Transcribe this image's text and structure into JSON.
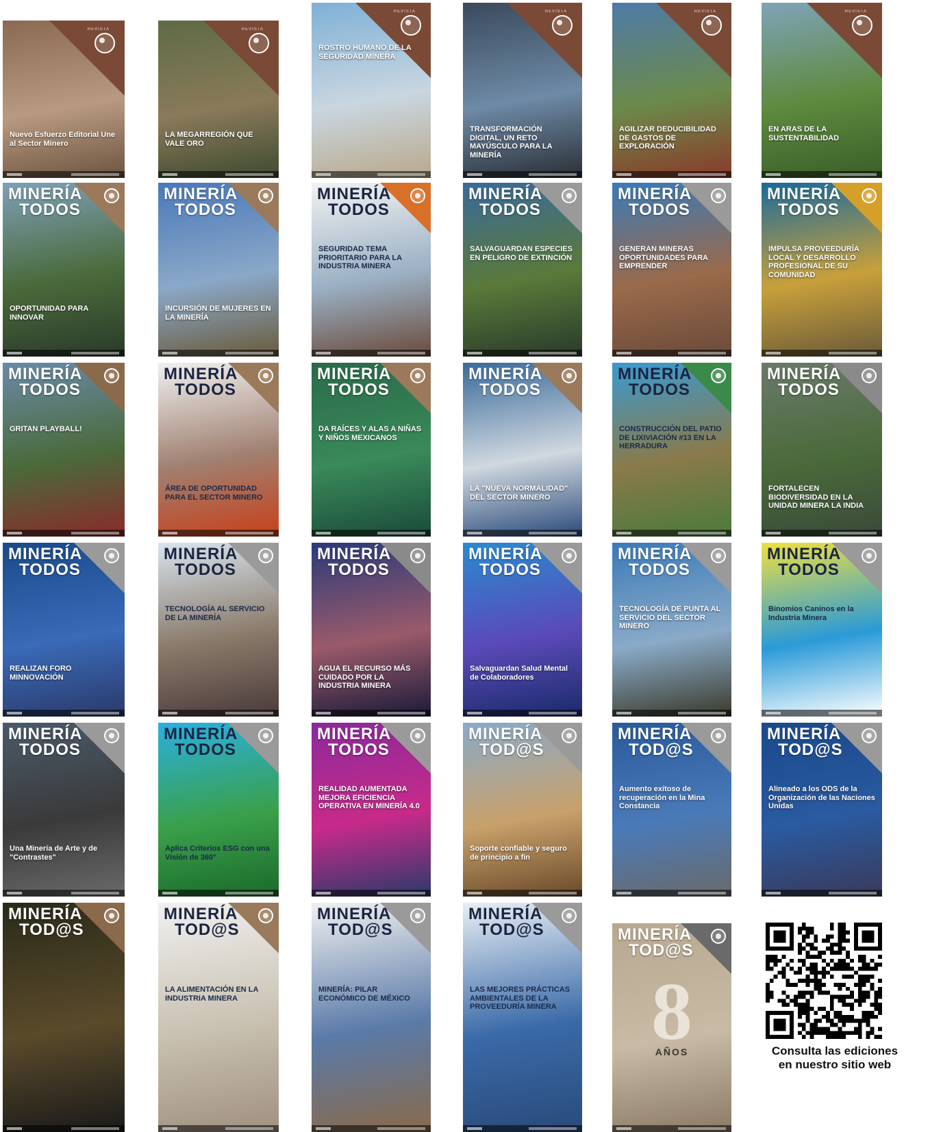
{
  "covers": [
    {
      "id": "c01",
      "era": "old",
      "headline": "Nuevo Esfuerzo Editorial Une al Sector Minero",
      "sub": "",
      "mast1": "",
      "mast2": "",
      "top_label": "REVISTA",
      "colors": [
        "#8a6a52",
        "#b89a80",
        "#6d5440"
      ],
      "corner": "#7a4a36",
      "hl_pos": "low"
    },
    {
      "id": "c02",
      "era": "old",
      "headline": "LA MEGARREGIÓN QUE VALE ORO",
      "sub": "",
      "mast1": "",
      "mast2": "",
      "top_label": "REVISTA",
      "colors": [
        "#5d6b44",
        "#8a7a5a",
        "#3e4a30"
      ],
      "corner": "#7a4a36",
      "hl_pos": "low"
    },
    {
      "id": "c03",
      "era": "old",
      "headline": "ROSTRO HUMANO DE LA SEGURIDAD MINERA",
      "sub": "",
      "mast1": "",
      "mast2": "",
      "top_label": "REVISTA",
      "colors": [
        "#7fb0d6",
        "#c9d6e0",
        "#b9a88a"
      ],
      "corner": "#7a4a36",
      "hl_pos": "top"
    },
    {
      "id": "c04",
      "era": "old",
      "headline": "TRANSFORMACIÓN DIGITAL, UN RETO MAYÚSCULO PARA LA MINERÍA",
      "sub": "",
      "mast1": "",
      "mast2": "",
      "top_label": "REVISTA",
      "colors": [
        "#3a4a5c",
        "#6e8aa6",
        "#2a2f36"
      ],
      "corner": "#7a4a36",
      "hl_pos": "low"
    },
    {
      "id": "c05",
      "era": "old",
      "headline": "AGILIZAR DEDUCIBILIDAD DE GASTOS DE EXPLORACIÓN",
      "sub": "",
      "mast1": "",
      "mast2": "",
      "top_label": "REVISTA",
      "colors": [
        "#4f7aa8",
        "#6b8a4a",
        "#8a3a2a"
      ],
      "corner": "#7a4a36",
      "hl_pos": "low"
    },
    {
      "id": "c06",
      "era": "old",
      "headline": "EN ARAS DE LA SUSTENTABILIDAD",
      "sub": "",
      "mast1": "",
      "mast2": "",
      "top_label": "REVISTA",
      "colors": [
        "#7fa3b8",
        "#5e8a3e",
        "#3a5e2a"
      ],
      "corner": "#7a4a36",
      "hl_pos": "low"
    },
    {
      "id": "c07",
      "era": "new",
      "headline": "OPORTUNIDAD PARA INNOVAR",
      "mast1": "MINERÍA",
      "mast2": "TODOS",
      "colors": [
        "#7ea0b8",
        "#4a6a3a",
        "#2a3a2a"
      ],
      "corner": "#9a7a5a",
      "hl_pos": "low"
    },
    {
      "id": "c08",
      "era": "new",
      "headline": "INCURSIÓN DE MUJERES EN LA MINERÍA",
      "mast1": "MINERÍA",
      "mast2": "TODOS",
      "colors": [
        "#4a78b8",
        "#8aa8c8",
        "#6a5a3a"
      ],
      "corner": "#9a7a5a",
      "hl_pos": "low"
    },
    {
      "id": "c09",
      "era": "new",
      "headline": "SEGURIDAD TEMA PRIORITARIO PARA LA INDUSTRIA MINERA",
      "mast1": "MINERÍA",
      "mast2": "TODOS",
      "colors": [
        "#f2f2f2",
        "#9ab0c4",
        "#6a4a3a"
      ],
      "corner": "#d9702a",
      "hl_pos": "mid",
      "dark": true
    },
    {
      "id": "c10",
      "era": "new",
      "headline": "SALVAGUARDAN ESPECIES EN PELIGRO DE EXTINCIÓN",
      "mast1": "MINERÍA",
      "mast2": "TODOS",
      "colors": [
        "#3a6a9a",
        "#5a7a3a",
        "#2a3a2a"
      ],
      "corner": "#9a9a9a",
      "hl_pos": "mid"
    },
    {
      "id": "c11",
      "era": "new",
      "headline": "GENERAN MINERAS OPORTUNIDADES PARA EMPRENDER",
      "mast1": "MINERÍA",
      "mast2": "TODOS",
      "colors": [
        "#3a7ab8",
        "#9a6a4a",
        "#6a4a3a"
      ],
      "corner": "#9a9a9a",
      "hl_pos": "mid"
    },
    {
      "id": "c12",
      "era": "new",
      "headline": "IMPULSA PROVEEDURÍA LOCAL Y DESARROLLO PROFESIONAL DE SU COMUNIDAD",
      "mast1": "MINERÍA",
      "mast2": "TODOS",
      "colors": [
        "#1a6a9a",
        "#c8a03a",
        "#6a5a3a"
      ],
      "corner": "#d4a02a",
      "hl_pos": "mid"
    },
    {
      "id": "c13",
      "era": "new",
      "headline": "GRITAN PLAYBALL!",
      "mast1": "MINERÍA",
      "mast2": "TODOS",
      "colors": [
        "#6a8aa8",
        "#4a6a3a",
        "#8a2a2a"
      ],
      "corner": "#8a6a4a",
      "hl_pos": "mid"
    },
    {
      "id": "c14",
      "era": "new",
      "headline": "ÁREA DE OPORTUNIDAD PARA EL SECTOR MINERO",
      "mast1": "MINERÍA",
      "mast2": "TODOS",
      "colors": [
        "#f0f0f0",
        "#a08070",
        "#c8401a"
      ],
      "corner": "#9a7a5a",
      "hl_pos": "low",
      "dark": true
    },
    {
      "id": "c15",
      "era": "new",
      "headline": "DA RAÍCES Y ALAS A NIÑAS Y NIÑOS MEXICANOS",
      "mast1": "MINERÍA",
      "mast2": "TODOS",
      "colors": [
        "#2a6a4a",
        "#3a8a5a",
        "#1a4a3a"
      ],
      "corner": "#9a7a5a",
      "hl_pos": "mid"
    },
    {
      "id": "c16",
      "era": "new",
      "headline": "LA \"NUEVA NORMALIDAD\" DEL SECTOR MINERO",
      "mast1": "MINERÍA",
      "mast2": "TODOS",
      "colors": [
        "#3a6a9a",
        "#d0d8e0",
        "#2a4a7a"
      ],
      "corner": "#9a7a5a",
      "hl_pos": "low"
    },
    {
      "id": "c17",
      "era": "new",
      "headline": "CONSTRUCCIÓN DEL PATIO DE LIXIVIACIÓN #13 EN LA HERRADURA",
      "mast1": "MINERÍA",
      "mast2": "TODOS",
      "colors": [
        "#3a9ad0",
        "#8a7a4a",
        "#4a7a3a"
      ],
      "corner": "#3a8a4a",
      "hl_pos": "mid",
      "dark": true
    },
    {
      "id": "c18",
      "era": "new",
      "headline": "FORTALECEN BIODIVERSIDAD EN LA UNIDAD MINERA LA INDIA",
      "mast1": "MINERÍA",
      "mast2": "TODOS",
      "colors": [
        "#6a7a6a",
        "#4a6a3a",
        "#3a4a3a"
      ],
      "corner": "#8a8a8a",
      "hl_pos": "low"
    },
    {
      "id": "c19",
      "era": "new",
      "headline": "REALIZAN FORO MINNOVACIÓN",
      "mast1": "MINERÍA",
      "mast2": "TODOS",
      "colors": [
        "#1a4a8a",
        "#3a6ab8",
        "#2a3a6a"
      ],
      "corner": "#9a9a9a",
      "hl_pos": "low"
    },
    {
      "id": "c20",
      "era": "new",
      "headline": "TECNOLOGÍA AL SERVICIO DE LA MINERÍA",
      "mast1": "MINERÍA",
      "mast2": "TODOS",
      "colors": [
        "#d8e4ee",
        "#8a7a6a",
        "#4a3a3a"
      ],
      "corner": "#9a9a9a",
      "hl_pos": "mid",
      "dark": true
    },
    {
      "id": "c21",
      "era": "new",
      "headline": "AGUA EL RECURSO MÁS CUIDADO POR LA INDUSTRIA MINERA",
      "mast1": "MINERÍA",
      "mast2": "TODOS",
      "colors": [
        "#2a3a7a",
        "#9a5a6a",
        "#1a1a3a"
      ],
      "corner": "#8a8a8a",
      "hl_pos": "low"
    },
    {
      "id": "c22",
      "era": "new",
      "headline": "Salvaguardan Salud Mental de Colaboradores",
      "mast1": "MINERÍA",
      "mast2": "TODOS",
      "colors": [
        "#2a8ad0",
        "#5a4ab8",
        "#1a2a6a"
      ],
      "corner": "#9a9a9a",
      "hl_pos": "low"
    },
    {
      "id": "c23",
      "era": "new",
      "headline": "TECNOLOGÍA DE PUNTA AL SERVICIO DEL SECTOR MINERO",
      "mast1": "MINERÍA",
      "mast2": "TODOS",
      "colors": [
        "#3a7ab8",
        "#8aaac8",
        "#3a3a2a"
      ],
      "corner": "#9a9a9a",
      "hl_pos": "mid"
    },
    {
      "id": "c24",
      "era": "new",
      "headline": "Binomios Caninos en la Industria Minera",
      "mast1": "MINERÍA",
      "mast2": "TODOS",
      "colors": [
        "#f0e040",
        "#2a9ad8",
        "#ffffff"
      ],
      "corner": "#9a9a9a",
      "hl_pos": "mid",
      "dark": true
    },
    {
      "id": "c25",
      "era": "new",
      "headline": "Una Minería de Arte y de \"Contrastes\"",
      "mast1": "MINERÍA",
      "mast2": "TODOS",
      "colors": [
        "#4a5a6a",
        "#3a3a3a",
        "#6a6a6a"
      ],
      "corner": "#9a9a9a",
      "hl_pos": "low"
    },
    {
      "id": "c26",
      "era": "new",
      "headline": "Aplica Criterios ESG con una Visión de 360°",
      "mast1": "MINERÍA",
      "mast2": "TODOS",
      "colors": [
        "#2ab0e0",
        "#3aa04a",
        "#1a6a2a"
      ],
      "corner": "#9a9a9a",
      "hl_pos": "low",
      "dark": true
    },
    {
      "id": "c27",
      "era": "new",
      "headline": "REALIDAD AUMENTADA MEJORA EFICIENCIA OPERATIVA EN MINERÍA 4.0",
      "mast1": "MINERÍA",
      "mast2": "TODOS",
      "colors": [
        "#8a2a9a",
        "#c82a8a",
        "#2a3a6a"
      ],
      "corner": "#9a9a9a",
      "hl_pos": "mid"
    },
    {
      "id": "c28",
      "era": "new",
      "headline": "Soporte confiable y seguro de principio a fin",
      "mast1": "MINERÍA",
      "mast2": "TOD@S",
      "colors": [
        "#8aaac8",
        "#c8a06a",
        "#6a4a2a"
      ],
      "corner": "#9a9a9a",
      "hl_pos": "low"
    },
    {
      "id": "c29",
      "era": "new",
      "headline": "Aumento exitoso de recuperación en la Mina Constancia",
      "mast1": "MINERÍA",
      "mast2": "TOD@S",
      "colors": [
        "#2a5a9a",
        "#4a7ab8",
        "#6a6a6a"
      ],
      "corner": "#9a9a9a",
      "hl_pos": "mid"
    },
    {
      "id": "c30",
      "era": "new",
      "headline": "Alineado a los ODS de la Organización de las Naciones Unidas",
      "mast1": "MINERÍA",
      "mast2": "TOD@S",
      "colors": [
        "#1a4a8a",
        "#2a5aa0",
        "#3a3a5a"
      ],
      "corner": "#9a9a9a",
      "hl_pos": "mid"
    },
    {
      "id": "c31",
      "era": "new",
      "headline": "",
      "mast1": "MINERÍA",
      "mast2": "TOD@S",
      "colors": [
        "#2a2a1a",
        "#5a4a2a",
        "#1a1a1a"
      ],
      "corner": "#8a6a4a",
      "hl_pos": "low"
    },
    {
      "id": "c32",
      "era": "new",
      "headline": "LA ALIMENTACIÓN EN LA INDUSTRIA MINERA",
      "mast1": "MINERÍA",
      "mast2": "TOD@S",
      "colors": [
        "#f0f0f0",
        "#c8c0b0",
        "#a09080"
      ],
      "corner": "#9a7a5a",
      "hl_pos": "mid",
      "dark": true
    },
    {
      "id": "c33",
      "era": "new",
      "headline": "MINERÍA: PILAR ECONÓMICO DE MÉXICO",
      "mast1": "MINERÍA",
      "mast2": "TOD@S",
      "colors": [
        "#f0f0f0",
        "#5a7aa8",
        "#8a6a4a"
      ],
      "corner": "#9a9a9a",
      "hl_pos": "mid",
      "dark": true
    },
    {
      "id": "c34",
      "era": "new",
      "headline": "LAS MEJORES PRÁCTICAS AMBIENTALES DE LA PROVEEDURÍA MINERA",
      "mast1": "MINERÍA",
      "mast2": "TOD@S",
      "colors": [
        "#e8eef4",
        "#3a6aa8",
        "#2a4a7a"
      ],
      "corner": "#9a9a9a",
      "hl_pos": "mid",
      "dark": true
    },
    {
      "id": "c35",
      "era": "anniv",
      "headline": "AÑOS",
      "big": "8",
      "mast1": "MINERÍA",
      "mast2": "TOD@S",
      "colors": [
        "#b8a890",
        "#c8baa4",
        "#8a7a66"
      ],
      "corner": "#6a6a6a",
      "hl_pos": "mid"
    }
  ],
  "qr_caption_line1": "Consulta las ediciones",
  "qr_caption_line2": "en nuestro sitio web"
}
